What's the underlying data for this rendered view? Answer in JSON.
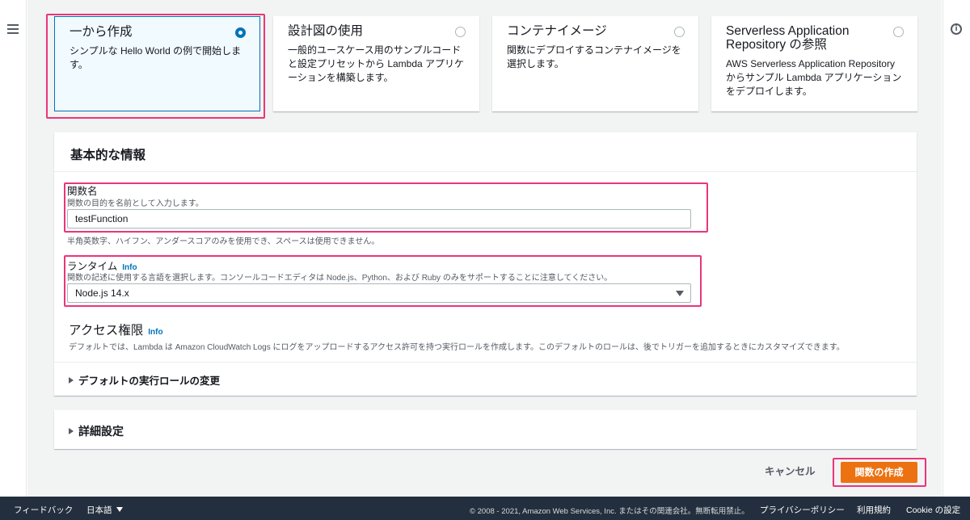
{
  "cards": [
    {
      "title": "一から作成",
      "desc": "シンプルな Hello World の例で開始します。",
      "selected": true
    },
    {
      "title": "設計図の使用",
      "desc": "一般的ユースケース用のサンプルコードと設定プリセットから Lambda アプリケーションを構築します。",
      "selected": false
    },
    {
      "title": "コンテナイメージ",
      "desc": "関数にデプロイするコンテナイメージを選択します。",
      "selected": false
    },
    {
      "title": "Serverless Application Repository の参照",
      "desc": "AWS Serverless Application Repository からサンプル Lambda アプリケーションをデプロイします。",
      "selected": false
    }
  ],
  "basic_info": {
    "header": "基本的な情報",
    "function_name": {
      "label": "関数名",
      "hint": "関数の目的を名前として入力します。",
      "value": "testFunction",
      "constraint": "半角英数字、ハイフン、アンダースコアのみを使用でき、スペースは使用できません。"
    },
    "runtime": {
      "label": "ランタイム",
      "info": "Info",
      "hint": "関数の記述に使用する言語を選択します。コンソールコードエディタは Node.js、Python、および Ruby のみをサポートすることに注意してください。",
      "value": "Node.js 14.x"
    },
    "permissions": {
      "title": "アクセス権限",
      "info": "Info",
      "desc": "デフォルトでは、Lambda は Amazon CloudWatch Logs にログをアップロードするアクセス許可を持つ実行ロールを作成します。このデフォルトのロールは、後でトリガーを追加するときにカスタマイズできます。",
      "expander": "デフォルトの実行ロールの変更"
    }
  },
  "advanced": {
    "label": "詳細設定"
  },
  "actions": {
    "cancel": "キャンセル",
    "create": "関数の作成"
  },
  "footer": {
    "feedback": "フィードバック",
    "language": "日本語",
    "copyright": "© 2008 - 2021, Amazon Web Services, Inc. またはその関連会社。無断転用禁止。",
    "privacy": "プライバシーポリシー",
    "terms": "利用規約",
    "cookie": "Cookie の設定"
  },
  "colors": {
    "accent": "#0073bb",
    "primary_button": "#ec7211",
    "highlight": "#ea357a",
    "footer_bg": "#232f3e"
  }
}
